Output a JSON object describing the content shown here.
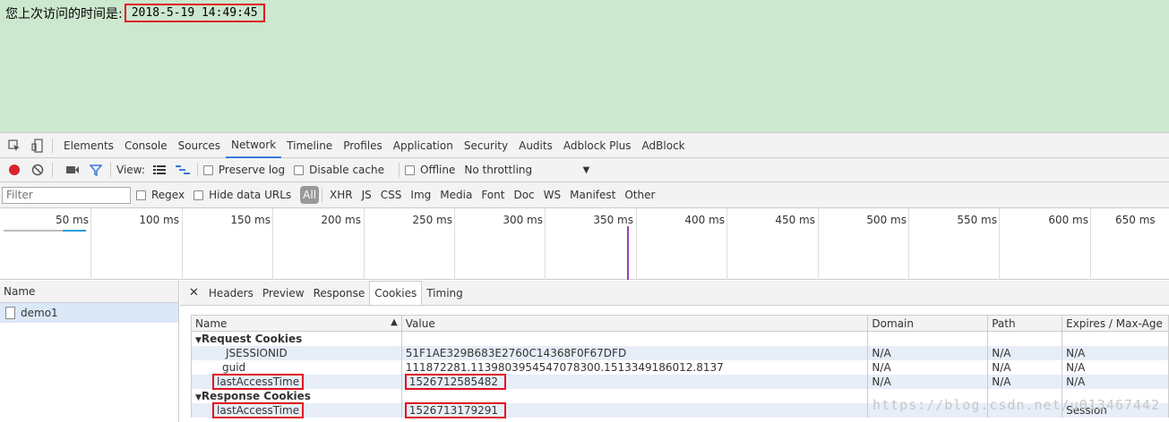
{
  "page": {
    "visit_label": "您上次访问的时间是:",
    "visit_time": "2018-5-19 14:49:45"
  },
  "devtools": {
    "panel_tabs": [
      "Elements",
      "Console",
      "Sources",
      "Network",
      "Timeline",
      "Profiles",
      "Application",
      "Security",
      "Audits",
      "Adblock Plus",
      "AdBlock"
    ],
    "active_panel": "Network",
    "toolbar": {
      "view_label": "View:",
      "preserve_log": "Preserve log",
      "disable_cache": "Disable cache",
      "offline": "Offline",
      "throttling": "No throttling"
    },
    "filter": {
      "placeholder": "Filter",
      "regex": "Regex",
      "hide_data_urls": "Hide data URLs",
      "types": [
        "All",
        "XHR",
        "JS",
        "CSS",
        "Img",
        "Media",
        "Font",
        "Doc",
        "WS",
        "Manifest",
        "Other"
      ]
    },
    "overview_ticks": [
      "50 ms",
      "100 ms",
      "150 ms",
      "200 ms",
      "250 ms",
      "300 ms",
      "350 ms",
      "400 ms",
      "450 ms",
      "500 ms",
      "550 ms",
      "600 ms",
      "650 ms"
    ],
    "name_column": "Name",
    "request_name": "demo1",
    "detail_tabs": [
      "Headers",
      "Preview",
      "Response",
      "Cookies",
      "Timing"
    ],
    "active_detail_tab": "Cookies",
    "cookie_columns": [
      "Name",
      "Value",
      "Domain",
      "Path",
      "Expires / Max-Age"
    ],
    "request_cookies_label": "Request Cookies",
    "response_cookies_label": "Response Cookies",
    "request_cookies": [
      {
        "name": "JSESSIONID",
        "value": "51F1AE329B683E2760C14368F0F67DFD",
        "domain": "N/A",
        "path": "N/A",
        "expires": "N/A"
      },
      {
        "name": "guid",
        "value": "111872281.1139803954547078300.1513349186012.8137",
        "domain": "N/A",
        "path": "N/A",
        "expires": "N/A"
      },
      {
        "name": "lastAccessTime",
        "value": "1526712585482",
        "domain": "N/A",
        "path": "N/A",
        "expires": "N/A"
      }
    ],
    "response_cookies": [
      {
        "name": "lastAccessTime",
        "value": "1526713179291",
        "domain": "",
        "path": "",
        "expires": "Session"
      }
    ]
  },
  "watermark": "https://blog.csdn.net/u013467442",
  "colors": {
    "page_bg": "#cce8cf",
    "highlight": "#e0141e",
    "active_tab": "#3879d9",
    "record": "#d9232d"
  }
}
